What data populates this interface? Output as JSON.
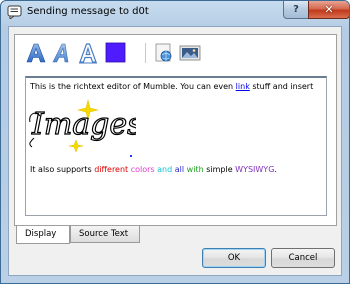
{
  "window": {
    "title": "Sending message to d0t",
    "help_label": "?",
    "close_label": "✕"
  },
  "toolbar": {
    "icons": [
      "bold-a-icon",
      "italic-a-icon",
      "outline-a-icon",
      "color-square-icon",
      "insert-link-icon",
      "insert-image-icon"
    ],
    "color_square": "#4f1cff"
  },
  "editor": {
    "line1_prefix": "This is the richtext editor of Mumble. You can even ",
    "line1_link": "link",
    "line1_suffix": " stuff and insert",
    "image_text": "Images",
    "line2_prefix": "It also supports ",
    "line2_word_different": "different",
    "line2_word_colors": "colors",
    "line2_word_and": "and",
    "line2_word_all": "all",
    "line2_word_with": "with",
    "line2_word_simple": "simple",
    "line2_word_wysiwyg": "WYSIWYG",
    "line2_period": "."
  },
  "tabs": {
    "display": "Display",
    "source": "Source Text"
  },
  "buttons": {
    "ok": "OK",
    "cancel": "Cancel"
  }
}
